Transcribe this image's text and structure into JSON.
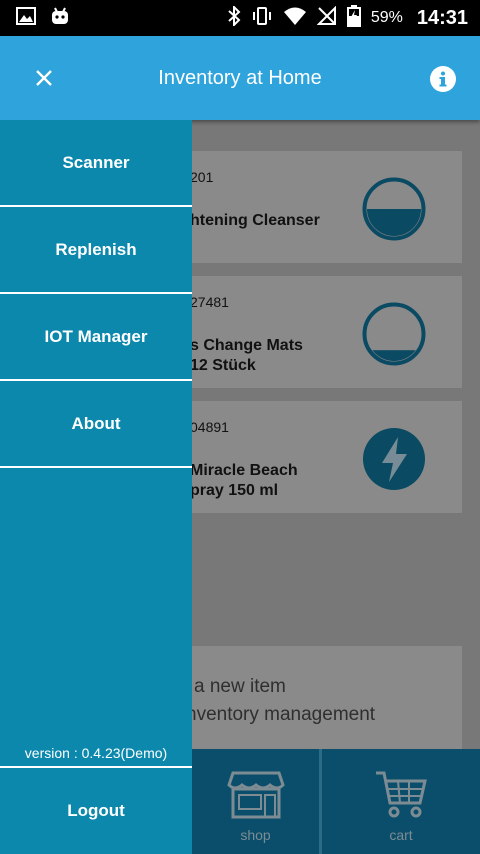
{
  "status_bar": {
    "battery_percent": "59%",
    "time": "14:31",
    "icons": [
      "image-icon",
      "android-icon",
      "bluetooth-icon",
      "vibrate-icon",
      "wifi-icon",
      "no-signal-icon",
      "battery-icon"
    ]
  },
  "app_bar": {
    "title": "Inventory at Home",
    "close_icon": "close-icon",
    "info_icon": "info-icon"
  },
  "drawer": {
    "items": [
      {
        "label": "Scanner"
      },
      {
        "label": "Replenish"
      },
      {
        "label": "IOT Manager"
      },
      {
        "label": "About"
      }
    ],
    "version": "version : 0.4.23(Demo)",
    "logout": "Logout"
  },
  "items": [
    {
      "code": "201",
      "name_line1": "htening Cleanser",
      "name_line2": "",
      "status_icon": "level-half-icon",
      "fill_fraction": 0.5
    },
    {
      "code": "27481",
      "name_line1": "s Change Mats",
      "name_line2": "12 Stück",
      "status_icon": "level-low-icon",
      "fill_fraction": 0.2
    },
    {
      "code": "04891",
      "name_line1": "Miracle Beach",
      "name_line2": "pray 150 ml",
      "status_icon": "lightning-icon"
    }
  ],
  "add_item": {
    "line1": "a new item",
    "line2": "nventory management"
  },
  "bottom_nav": {
    "shop": "shop",
    "cart": "cart"
  },
  "colors": {
    "app_bar": "#2fa3dc",
    "drawer": "#0c88ad",
    "bottom_nav": "#0a4e6b",
    "level_fill": "#0a4a63"
  }
}
